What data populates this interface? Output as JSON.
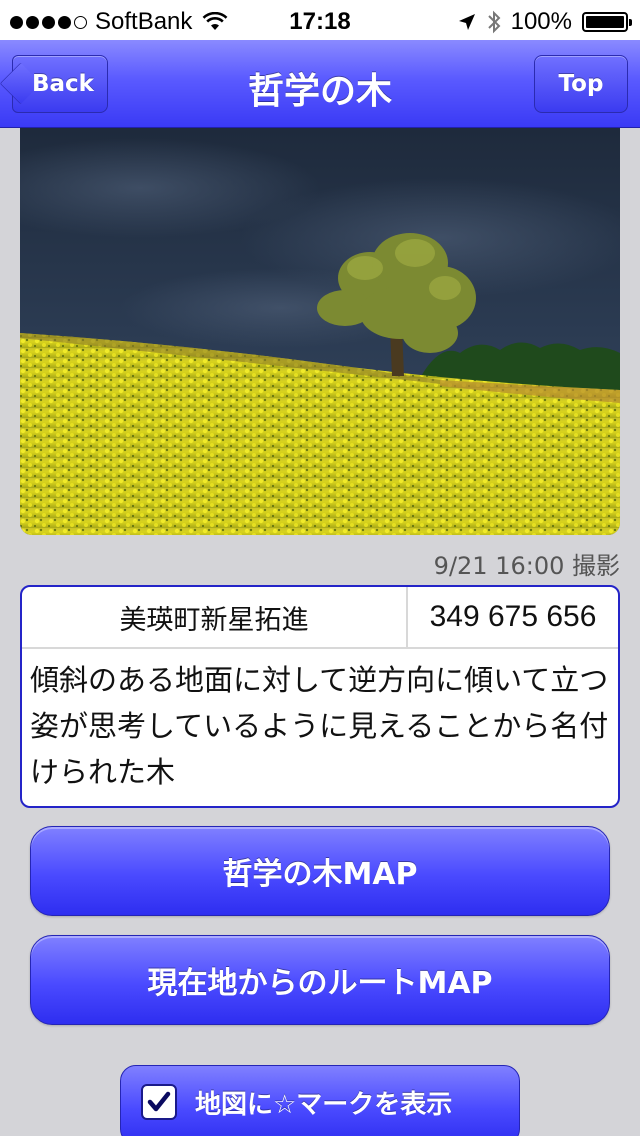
{
  "status_bar": {
    "carrier": "SoftBank",
    "time": "17:18",
    "battery": "100%",
    "signal_bars": 4,
    "signal_total": 5
  },
  "nav": {
    "title": "哲学の木",
    "back_label": "Back",
    "top_label": "Top"
  },
  "photo": {
    "caption": "9/21 16:00 撮影"
  },
  "info": {
    "place": "美瑛町新星拓進",
    "code": "349 675 656",
    "description": "傾斜のある地面に対して逆方向に傾いて立つ姿が思考しているように見えることから名付けられた木"
  },
  "buttons": {
    "map_label": "哲学の木MAP",
    "route_label": "現在地からのルートMAP"
  },
  "mark_toggle": {
    "label": "地図に☆マークを表示",
    "checked": true
  },
  "colors": {
    "accent": "#4a4aff",
    "border": "#2424c8",
    "background": "#d4d4d8"
  }
}
